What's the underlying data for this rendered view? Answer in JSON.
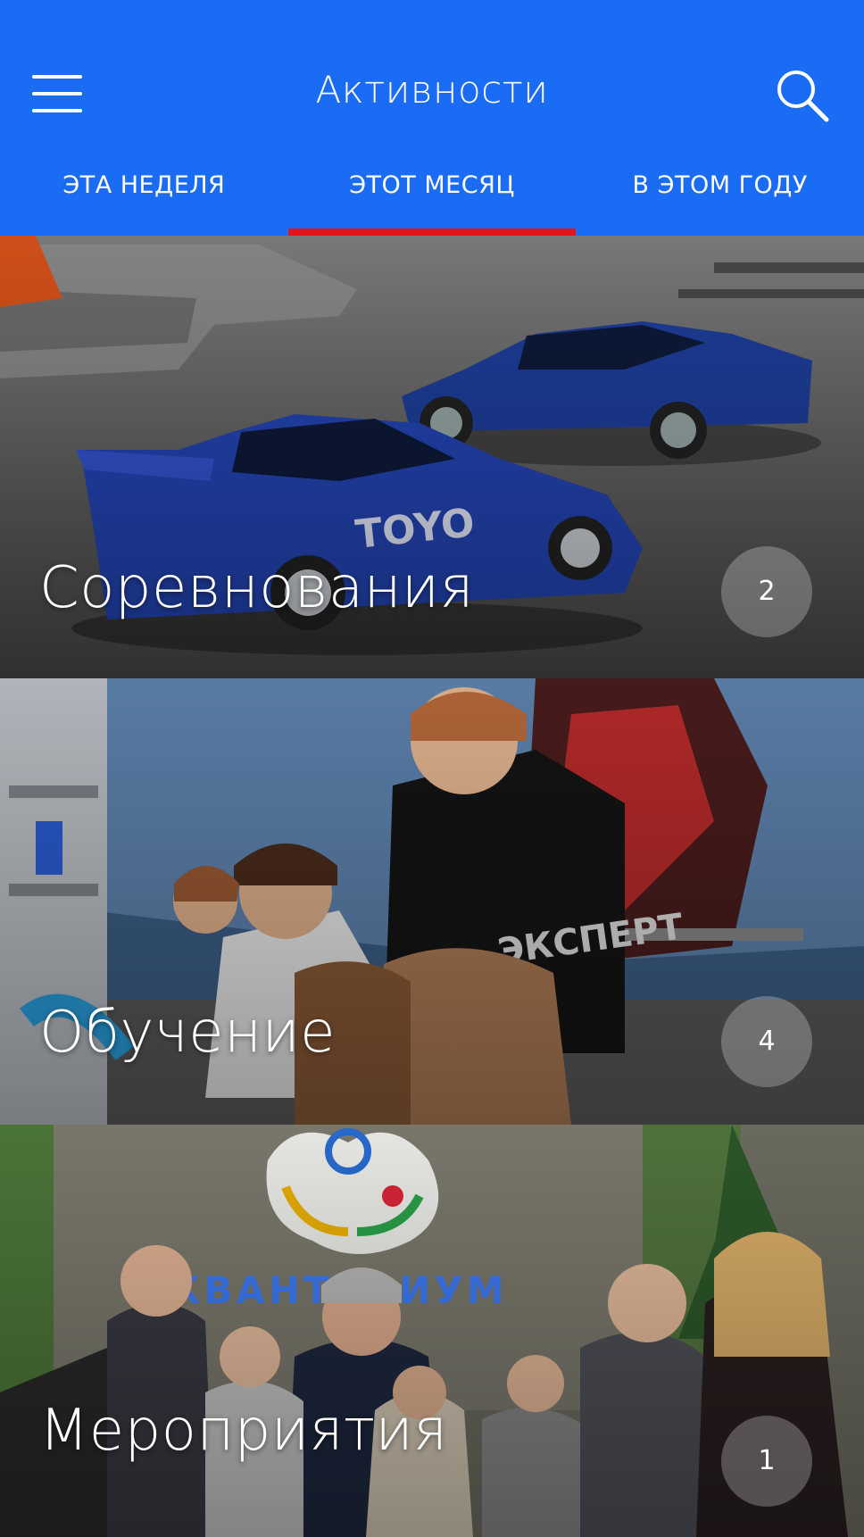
{
  "header": {
    "title": "Активности",
    "menu_icon": "hamburger-menu-icon",
    "search_icon": "search-icon",
    "color": "#1a6cf5",
    "active_tab_indicator_color": "#e3141b"
  },
  "tabs": [
    {
      "label": "ЭТА НЕДЕЛЯ",
      "active": false
    },
    {
      "label": "ЭТОТ МЕСЯЦ",
      "active": true
    },
    {
      "label": "В ЭТОМ ГОДУ",
      "active": false
    }
  ],
  "categories": [
    {
      "title": "Соревнования",
      "count": "2"
    },
    {
      "title": "Обучение",
      "count": "4"
    },
    {
      "title": "Мероприятия",
      "count": "1"
    }
  ]
}
